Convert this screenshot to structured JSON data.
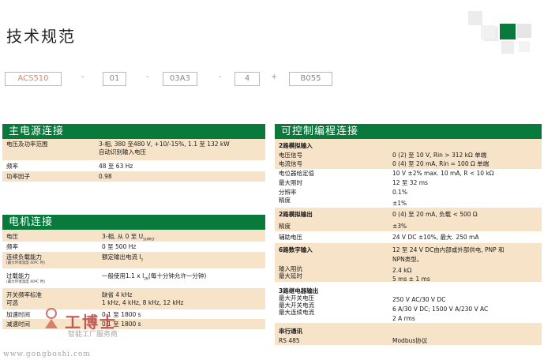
{
  "page": {
    "title": "技术规范"
  },
  "code": {
    "parts": [
      "ACS510",
      "01",
      "03A3",
      "4",
      "B055"
    ],
    "separators": [
      "-",
      "-",
      "-",
      "+"
    ]
  },
  "power": {
    "title": "主电源连接",
    "rows": [
      {
        "k": "电压及功率范围",
        "v": "3-相, 380 至480 V, +10/-15%, 1.1 至 132 kW",
        "v2": "自动识别输入电压"
      },
      {
        "k": "频率",
        "v": "48 至 63 Hz"
      },
      {
        "k": "功率因子",
        "v": "0.98"
      }
    ]
  },
  "motor": {
    "title": "电机连接",
    "rows": [
      {
        "k": "电压",
        "v": "3-相, 从 0 至 U",
        "vsub": "SUPPLY"
      },
      {
        "k": "频率",
        "v": "0 至 500 Hz"
      },
      {
        "k": "连续负载能力",
        "ksub": "(最大环境温度 40ºC 时)",
        "v": "额定输出电流 I",
        "vsub": "2"
      },
      {
        "k": "过载能力",
        "ksub": "(最大环境温度 40ºC 时)",
        "v": "一般使用1.1 x I",
        "vsub": "2N",
        "vtail": "(每十分钟允许一分钟)"
      },
      {
        "k": "开关频率标准",
        "k2": "可选",
        "v": "缺省 4 kHz",
        "v2": "1 kHz, 4 kHz, 8 kHz, 12 kHz"
      },
      {
        "k": "加速时间",
        "v": "0.1 至 1800 s"
      },
      {
        "k": "减速时间",
        "v": "0.1 至 1800 s"
      }
    ]
  },
  "control": {
    "title": "可控制编程连接",
    "rows": [
      {
        "k": "2路模拟输入",
        "bold": true
      },
      {
        "k": "电压信号",
        "v": "0 (2) 至 10 V, Rin > 312 kΩ 单端"
      },
      {
        "k": "电流信号",
        "v": "0 (4) 至 20 mA, Rin = 100 Ω 单端"
      },
      {
        "k": "电位器给定值",
        "v": "10 V ±2% max. 10 mA, R < 10 kΩ"
      },
      {
        "k": "最大限时",
        "v": "12 至 32 ms"
      },
      {
        "k": "分辨率",
        "v": "0.1%"
      },
      {
        "k": "精度",
        "v": "±1%"
      },
      {
        "k": "2路模拟输出",
        "v": "0 (4) 至 20 mA, 负载 < 500 Ω",
        "bold": true
      },
      {
        "k": "精度",
        "v": "±3%"
      },
      {
        "k": "辅助电压",
        "v": "24 V DC ±10%, 最大. 250 mA"
      },
      {
        "k": "6路数字输入",
        "v": "12 至 24 V DC由内部或外部供电, PNP 和",
        "v2": "NPN类型。",
        "bold": true
      },
      {
        "k": "输入阻抗",
        "v": "2.4 kΩ"
      },
      {
        "k": "最大延时",
        "v": "5 ms ± 1 ms"
      },
      {
        "k": "3路继电器输出",
        "bold": true
      },
      {
        "k": "最大开关电压",
        "v": "250 V AC/30 V DC"
      },
      {
        "k": "最大开关电流",
        "v": "6 A/30 V DC; 1500 V A/230 V AC"
      },
      {
        "k": "最大连续电流",
        "v": "2 A rms"
      },
      {
        "k": "串行通讯",
        "bold": true
      },
      {
        "k": "RS 485",
        "v": "Modbus协议"
      }
    ]
  },
  "watermark": {
    "brand": "工博士",
    "tagline": "智能工厂服务商",
    "url": "www.gongboshi.com"
  },
  "colors": {
    "header_green": "#0a7a3c",
    "row_beige": "#f7e3c8"
  }
}
